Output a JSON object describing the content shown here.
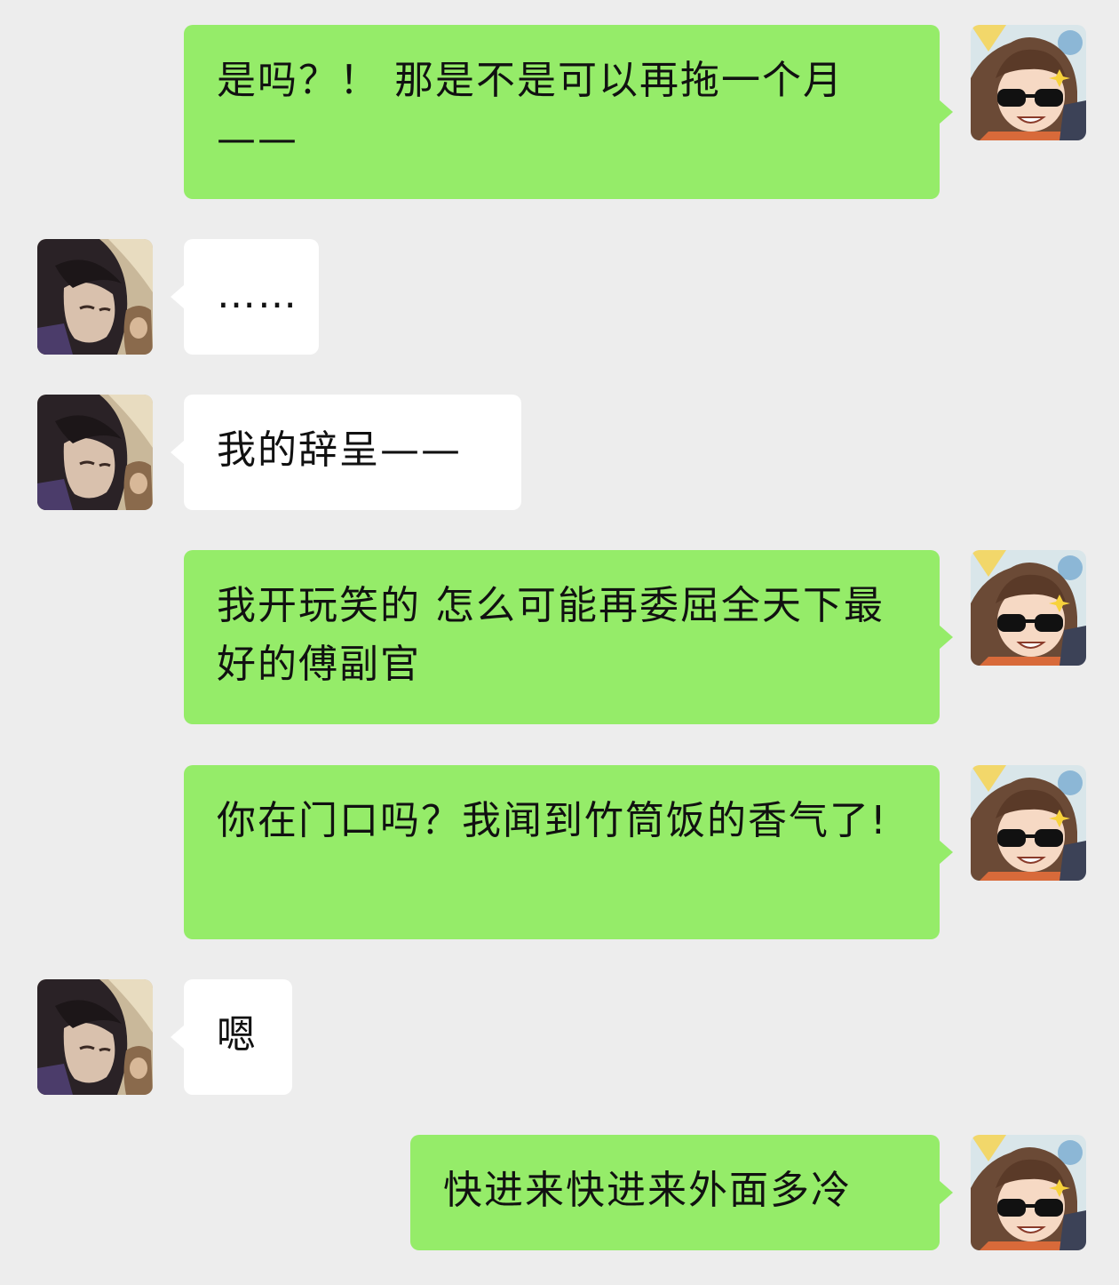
{
  "colors": {
    "background": "#ededed",
    "my_bubble": "#95ec69",
    "other_bubble": "#ffffff"
  },
  "avatars": {
    "me": "chibi-sunglasses-avatar",
    "other": "dark-haired-man-avatar"
  },
  "messages": [
    {
      "sender": "me",
      "text": "是吗？！ 那是不是可以再拖一个月——"
    },
    {
      "sender": "other",
      "text": "……"
    },
    {
      "sender": "other",
      "text": "我的辞呈——"
    },
    {
      "sender": "me",
      "text": "我开玩笑的 怎么可能再委屈全天下最好的傅副官"
    },
    {
      "sender": "me",
      "text": "你在门口吗？我闻到竹筒饭的香气了!"
    },
    {
      "sender": "other",
      "text": "嗯"
    },
    {
      "sender": "me",
      "text": "快进来快进来外面多冷"
    }
  ]
}
